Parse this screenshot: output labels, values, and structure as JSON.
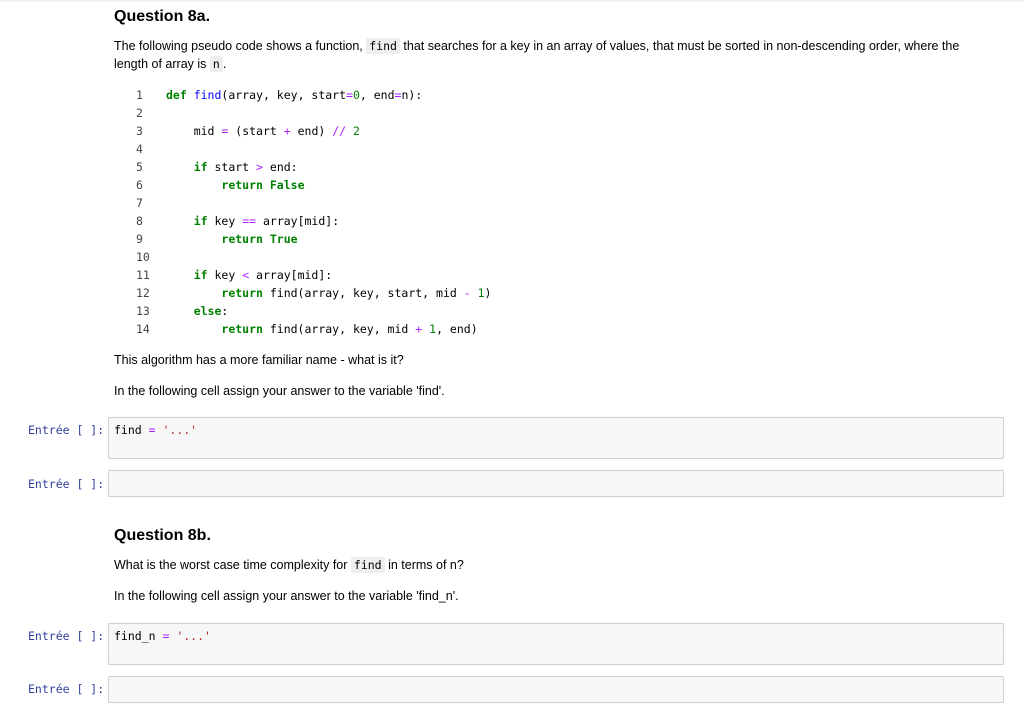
{
  "q8a": {
    "title": "Question 8a.",
    "desc_pre": "The following pseudo code shows a function, ",
    "desc_code": "find",
    "desc_mid": " that searches for a key in an array of values, that must be sorted in non-descending order, where the",
    "desc_line2_pre": "length of array is ",
    "desc_line2_code": "n",
    "desc_line2_post": ".",
    "code_lines": [
      {
        "n": "1",
        "indent": "",
        "tokens": [
          [
            "kw",
            "def "
          ],
          [
            "fn",
            "find"
          ],
          [
            "t",
            "(array, key, start"
          ],
          [
            "op",
            "="
          ],
          [
            "num",
            "0"
          ],
          [
            "t",
            ", end"
          ],
          [
            "op",
            "="
          ],
          [
            "t",
            "n):"
          ]
        ]
      },
      {
        "n": "2",
        "indent": "",
        "tokens": []
      },
      {
        "n": "3",
        "indent": "    ",
        "tokens": [
          [
            "t",
            "mid "
          ],
          [
            "op",
            "="
          ],
          [
            "t",
            " (start "
          ],
          [
            "op",
            "+"
          ],
          [
            "t",
            " end) "
          ],
          [
            "op",
            "//"
          ],
          [
            "t",
            " "
          ],
          [
            "num",
            "2"
          ]
        ]
      },
      {
        "n": "4",
        "indent": "",
        "tokens": []
      },
      {
        "n": "5",
        "indent": "    ",
        "tokens": [
          [
            "kw",
            "if"
          ],
          [
            "t",
            " start "
          ],
          [
            "op",
            ">"
          ],
          [
            "t",
            " end:"
          ]
        ]
      },
      {
        "n": "6",
        "indent": "        ",
        "tokens": [
          [
            "kw",
            "return"
          ],
          [
            "t",
            " "
          ],
          [
            "kw",
            "False"
          ]
        ]
      },
      {
        "n": "7",
        "indent": "",
        "tokens": []
      },
      {
        "n": "8",
        "indent": "    ",
        "tokens": [
          [
            "kw",
            "if"
          ],
          [
            "t",
            " key "
          ],
          [
            "op",
            "=="
          ],
          [
            "t",
            " array[mid]:"
          ]
        ]
      },
      {
        "n": "9",
        "indent": "        ",
        "tokens": [
          [
            "kw",
            "return"
          ],
          [
            "t",
            " "
          ],
          [
            "kw",
            "True"
          ]
        ]
      },
      {
        "n": "10",
        "indent": "",
        "tokens": []
      },
      {
        "n": "11",
        "indent": "    ",
        "tokens": [
          [
            "kw",
            "if"
          ],
          [
            "t",
            " key "
          ],
          [
            "op",
            "<"
          ],
          [
            "t",
            " array[mid]:"
          ]
        ]
      },
      {
        "n": "12",
        "indent": "        ",
        "tokens": [
          [
            "kw",
            "return"
          ],
          [
            "t",
            " find(array, key, start, mid "
          ],
          [
            "op",
            "-"
          ],
          [
            "t",
            " "
          ],
          [
            "num",
            "1"
          ],
          [
            "t",
            ")"
          ]
        ]
      },
      {
        "n": "13",
        "indent": "    ",
        "tokens": [
          [
            "kw",
            "else"
          ],
          [
            "t",
            ":"
          ]
        ]
      },
      {
        "n": "14",
        "indent": "        ",
        "tokens": [
          [
            "kw",
            "return"
          ],
          [
            "t",
            " find(array, key, mid "
          ],
          [
            "op",
            "+"
          ],
          [
            "t",
            " "
          ],
          [
            "num",
            "1"
          ],
          [
            "t",
            ", end)"
          ]
        ]
      }
    ],
    "question": "This algorithm has a more familiar name - what is it?",
    "instruction": "In the following cell assign your answer to the variable 'find'."
  },
  "cells": {
    "prompt": "Entrée [ ]:",
    "cell1_var": "find",
    "cell1_eq": " = ",
    "cell1_str": "'...'",
    "cell3_var": "find_n",
    "cell3_eq": " = ",
    "cell3_str": "'...'"
  },
  "q8b": {
    "title": "Question 8b.",
    "q_pre": "What is the worst case time complexity for ",
    "q_code": "find",
    "q_post": " in terms of n?",
    "instruction": "In the following cell assign your answer to the variable 'find_n'."
  }
}
